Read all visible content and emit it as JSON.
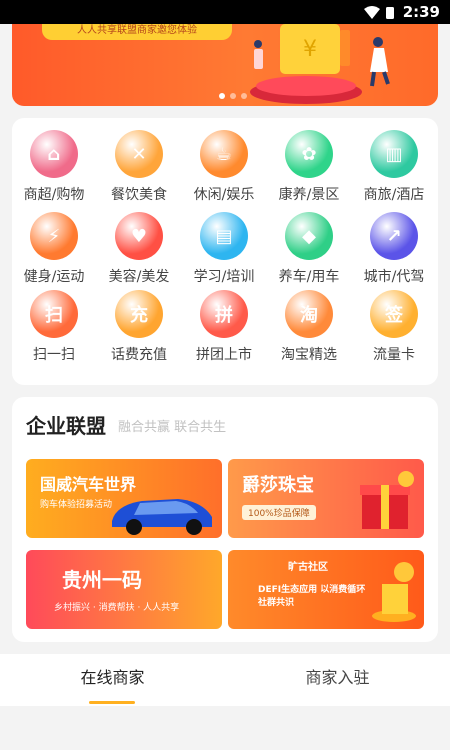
{
  "status_bar": {
    "time": "2:39"
  },
  "banner": {
    "tag_text": "人人共享联盟商家邀您体验",
    "coin_symbol": "¥",
    "page_count": 3,
    "active_page": 1
  },
  "categories": [
    {
      "label": "商超/购物",
      "color": "#f06b8a",
      "icon": "shop-icon"
    },
    {
      "label": "餐饮美食",
      "color": "#ffa53a",
      "icon": "cutlery-icon"
    },
    {
      "label": "休闲/娱乐",
      "color": "#ff8a2e",
      "icon": "coffee-icon"
    },
    {
      "label": "康养/景区",
      "color": "#2fd48a",
      "icon": "palm-tree-icon"
    },
    {
      "label": "商旅/酒店",
      "color": "#2ec9a0",
      "icon": "hotel-icon"
    },
    {
      "label": "健身/运动",
      "color": "#ff7a30",
      "icon": "running-icon"
    },
    {
      "label": "美容/美发",
      "color": "#ff5044",
      "icon": "beauty-icon"
    },
    {
      "label": "学习/培训",
      "color": "#2eb5f0",
      "icon": "book-icon"
    },
    {
      "label": "养车/用车",
      "color": "#2fcf87",
      "icon": "car-icon"
    },
    {
      "label": "城市/代驾",
      "color": "#5b54e8",
      "icon": "chart-icon"
    },
    {
      "label": "扫一扫",
      "color": "#ff6a3a",
      "icon": "scan-icon",
      "glyph": "扫"
    },
    {
      "label": "话费充值",
      "color": "#ffa530",
      "icon": "topup-icon",
      "glyph": "充"
    },
    {
      "label": "拼团上市",
      "color": "#ff5a4a",
      "icon": "alarm-clock-icon",
      "glyph": "拼"
    },
    {
      "label": "淘宝精选",
      "color": "#ff8a3a",
      "icon": "taobao-icon",
      "glyph": "淘"
    },
    {
      "label": "流量卡",
      "color": "#ffb030",
      "icon": "data-card-icon",
      "glyph": "签"
    }
  ],
  "alliance": {
    "title": "企业联盟",
    "subtitle": "融合共赢 联合共生",
    "tiles": [
      {
        "title": "国威汽车世界",
        "sub": "购车体验招募活动",
        "from": "#ffad1f",
        "to": "#ff6f2a",
        "icon": "car-promo-icon"
      },
      {
        "title": "爵莎珠宝",
        "sub": "100%珍品保障",
        "from": "#ff9a4a",
        "to": "#ff5a4a",
        "icon": "jewelry-promo-icon"
      },
      {
        "title": "贵州一码",
        "sub": "乡村振兴 · 消费帮扶 · 人人共享",
        "from": "#ff4a5a",
        "to": "#ffa82a",
        "icon": "guizhou-promo-icon"
      },
      {
        "title": "旷古社区",
        "sub": "DEFI生态应用 以消费循环社群共识",
        "from": "#ff8a2a",
        "to": "#ff5a1a",
        "icon": "community-promo-icon"
      }
    ]
  },
  "tabs": [
    {
      "label": "在线商家",
      "active": true
    },
    {
      "label": "商家入驻",
      "active": false
    }
  ]
}
